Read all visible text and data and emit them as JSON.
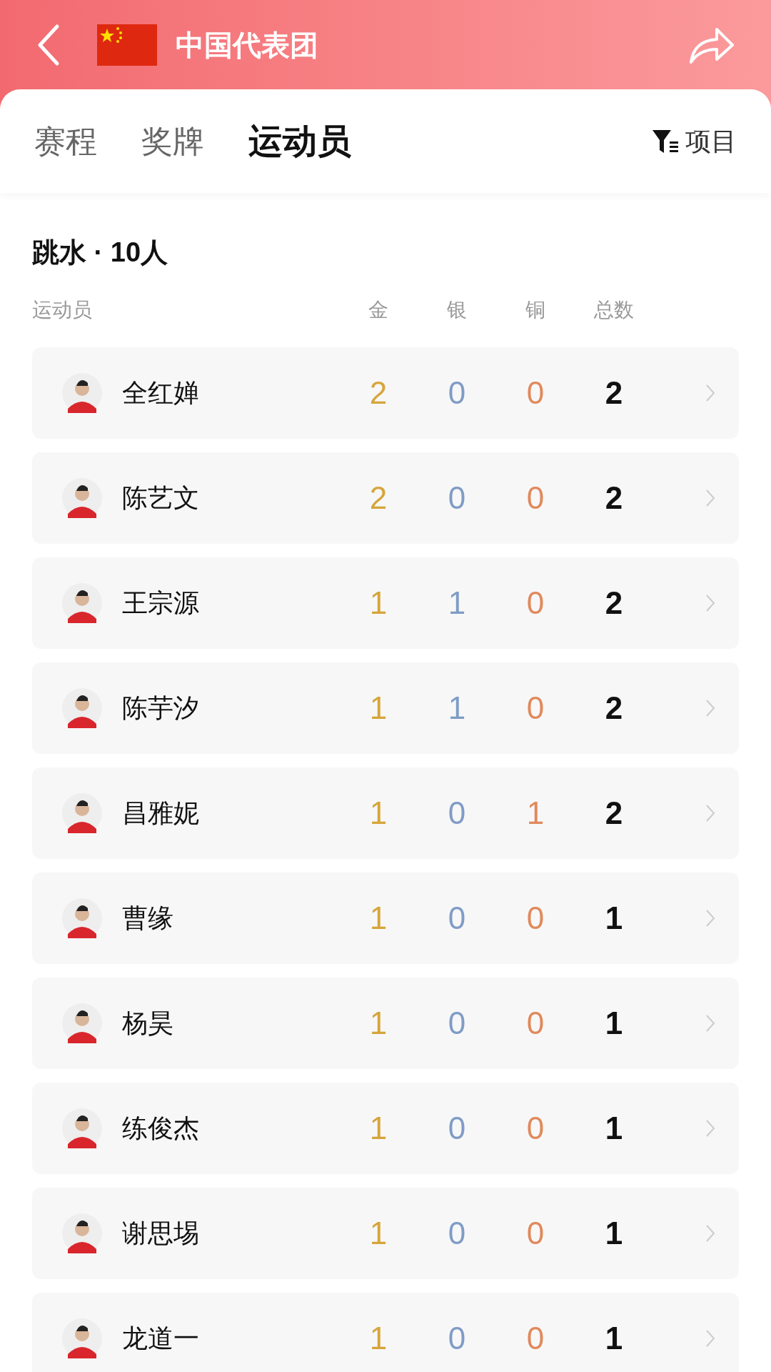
{
  "header": {
    "title": "中国代表团"
  },
  "tabs": [
    {
      "label": "赛程",
      "selected": false
    },
    {
      "label": "奖牌",
      "selected": false
    },
    {
      "label": "运动员",
      "selected": true
    }
  ],
  "filter": {
    "label": "项目"
  },
  "section": {
    "title": "跳水 · 10人"
  },
  "columns": [
    "运动员",
    "金",
    "银",
    "铜",
    "总数"
  ],
  "athletes": [
    {
      "name": "全红婵",
      "gold": "2",
      "silver": "0",
      "bronze": "0",
      "total": "2"
    },
    {
      "name": "陈艺文",
      "gold": "2",
      "silver": "0",
      "bronze": "0",
      "total": "2"
    },
    {
      "name": "王宗源",
      "gold": "1",
      "silver": "1",
      "bronze": "0",
      "total": "2"
    },
    {
      "name": "陈芋汐",
      "gold": "1",
      "silver": "1",
      "bronze": "0",
      "total": "2"
    },
    {
      "name": "昌雅妮",
      "gold": "1",
      "silver": "0",
      "bronze": "1",
      "total": "2"
    },
    {
      "name": "曹缘",
      "gold": "1",
      "silver": "0",
      "bronze": "0",
      "total": "1"
    },
    {
      "name": "杨昊",
      "gold": "1",
      "silver": "0",
      "bronze": "0",
      "total": "1"
    },
    {
      "name": "练俊杰",
      "gold": "1",
      "silver": "0",
      "bronze": "0",
      "total": "1"
    },
    {
      "name": "谢思埸",
      "gold": "1",
      "silver": "0",
      "bronze": "0",
      "total": "1"
    },
    {
      "name": "龙道一",
      "gold": "1",
      "silver": "0",
      "bronze": "0",
      "total": "1"
    }
  ]
}
